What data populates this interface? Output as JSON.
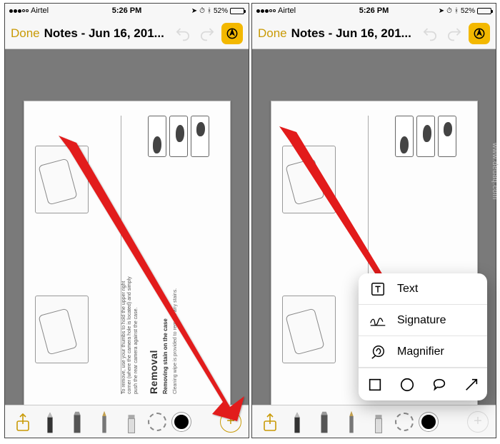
{
  "status": {
    "carrier": "Airtel",
    "time": "5:26 PM",
    "battery_pct": "52%"
  },
  "nav": {
    "done": "Done",
    "title": "Notes - Jun 16, 201..."
  },
  "scan": {
    "caption": "To remove, use your thumbs to hold the upper right corner (where the camera hole is located) and simply push the rear camera against the case.",
    "removal_title": "Removal",
    "removal_sub": "Removing stain on the case",
    "removal_para": "Cleaning wipe is provided to remove any stains."
  },
  "popup": {
    "text": "Text",
    "signature": "Signature",
    "magnifier": "Magnifier"
  },
  "watermark": "www.deuaq.com"
}
